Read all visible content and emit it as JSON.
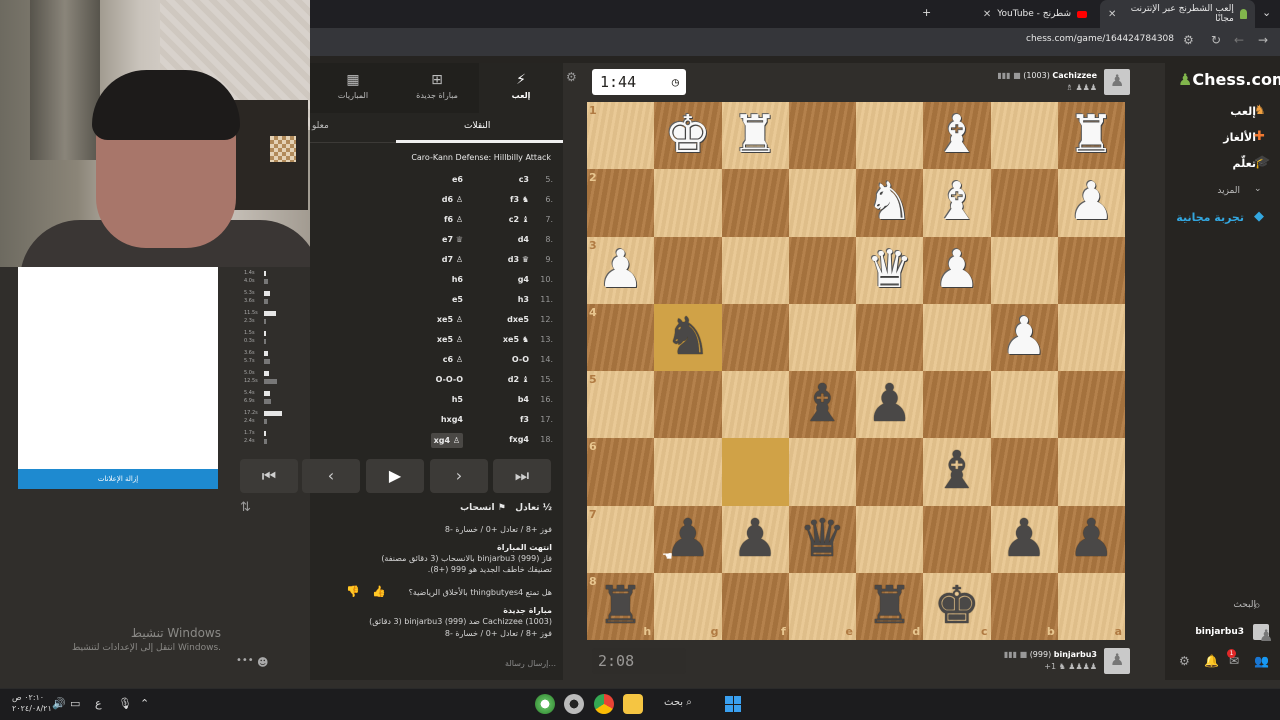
{
  "browser": {
    "tabs": [
      {
        "title": "إلعب الشطرنج عبر الإنترنت مجانًا",
        "active": true
      },
      {
        "title": "شطرنج - YouTube",
        "active": false
      }
    ],
    "new_tab": "+",
    "url": "chess.com/game/164424784308"
  },
  "overlay": {
    "remove_ads": "إزالة الإعلانات",
    "windows_activate_title": "تنشيط Windows",
    "windows_activate_sub": "انتقل إلى الإعدادات لتنشيط Windows."
  },
  "panel": {
    "tabs": [
      {
        "label": "إلعب",
        "icon": "lightning-icon"
      },
      {
        "label": "مباراة جديدة",
        "icon": "plus-square-icon"
      },
      {
        "label": "المباريات",
        "icon": "board-icon"
      }
    ],
    "subtabs": {
      "moves": "النقلات",
      "info": "معلو"
    },
    "opening": "Caro-Kann Defense: Hillbilly Attack",
    "moves": [
      {
        "num": "5.",
        "white": "c3",
        "black": "e6"
      },
      {
        "num": "6.",
        "white": "f3 ♞",
        "black": "d6 ♙"
      },
      {
        "num": "7.",
        "white": "c2 ♝",
        "black": "f6 ♙"
      },
      {
        "num": "8.",
        "white": "d4",
        "black": "e7 ♕"
      },
      {
        "num": "9.",
        "white": "d3 ♛",
        "black": "d7 ♙"
      },
      {
        "num": "10.",
        "white": "g4",
        "black": "h6"
      },
      {
        "num": "11.",
        "white": "h3",
        "black": "e5"
      },
      {
        "num": "12.",
        "white": "dxe5",
        "black": "xe5 ♙"
      },
      {
        "num": "13.",
        "white": "xe5 ♞",
        "black": "xe5 ♙"
      },
      {
        "num": "14.",
        "white": "O-O",
        "black": "c6 ♙"
      },
      {
        "num": "15.",
        "white": "d2 ♝",
        "black": "O-O-O"
      },
      {
        "num": "16.",
        "white": "b4",
        "black": "h5"
      },
      {
        "num": "17.",
        "white": "f3",
        "black": "hxg4"
      },
      {
        "num": "18.",
        "white": "fxg4",
        "black": "xg4 ♙"
      }
    ],
    "times": [
      [
        "1.4s",
        "4.0s"
      ],
      [
        "5.3s",
        "3.6s"
      ],
      [
        "11.5s",
        "2.3s"
      ],
      [
        "1.5s",
        "0.3s"
      ],
      [
        "3.6s",
        "5.7s"
      ],
      [
        "5.0s",
        "12.5s"
      ],
      [
        "5.4s",
        "6.9s"
      ],
      [
        "17.2s",
        "2.4s"
      ],
      [
        "1.7s",
        "2.4s"
      ]
    ],
    "draw_label": "½ تعادل",
    "resign_label": "انسحاب",
    "chat": {
      "line1": "فوز +8 / تعادل +0 / خسارة -8",
      "game_over": "انتهت المباراة",
      "result": "فاز binjarbu3 (999) بالانسحاب (3 دقائق مصنفة)",
      "rating": "تصنيفك خاطف الجديد هو 999 (+8).",
      "question": "هل تمتع thingbutyes4 بالأخلاق الرياضية؟",
      "new_game": "مباراة جديدة",
      "matchup": "Cachizzee (1003) ضد binjarbu3 (999) (3 دقائق)",
      "line2": "فوز +8 / تعادل +0 / خسارة -8"
    },
    "input_placeholder": "إرسال رسالة..."
  },
  "board": {
    "top_clock": "1:44",
    "bottom_clock": "2:08",
    "top_player": {
      "name": "Cachizzee",
      "rating": "(1003)"
    },
    "bottom_player": {
      "name": "binjarbu3",
      "rating": "(999)",
      "diff": "+1"
    },
    "ranks": [
      "1",
      "2",
      "3",
      "4",
      "5",
      "6",
      "7",
      "8"
    ],
    "files": [
      "h",
      "g",
      "f",
      "e",
      "d",
      "c",
      "b",
      "a"
    ],
    "pieces": [
      {
        "r": 0,
        "f": 1,
        "p": "♚",
        "c": "w"
      },
      {
        "r": 0,
        "f": 2,
        "p": "♜",
        "c": "w"
      },
      {
        "r": 0,
        "f": 5,
        "p": "♝",
        "c": "w"
      },
      {
        "r": 0,
        "f": 7,
        "p": "♜",
        "c": "w"
      },
      {
        "r": 1,
        "f": 4,
        "p": "♞",
        "c": "w"
      },
      {
        "r": 1,
        "f": 5,
        "p": "♝",
        "c": "w"
      },
      {
        "r": 1,
        "f": 7,
        "p": "♟",
        "c": "w"
      },
      {
        "r": 2,
        "f": 0,
        "p": "♟",
        "c": "w"
      },
      {
        "r": 2,
        "f": 4,
        "p": "♛",
        "c": "w"
      },
      {
        "r": 2,
        "f": 5,
        "p": "♟",
        "c": "w"
      },
      {
        "r": 3,
        "f": 1,
        "p": "♞",
        "c": "b"
      },
      {
        "r": 3,
        "f": 6,
        "p": "♟",
        "c": "w"
      },
      {
        "r": 4,
        "f": 3,
        "p": "♝",
        "c": "b"
      },
      {
        "r": 4,
        "f": 4,
        "p": "♟",
        "c": "b"
      },
      {
        "r": 5,
        "f": 5,
        "p": "♝",
        "c": "b"
      },
      {
        "r": 6,
        "f": 1,
        "p": "♟",
        "c": "b"
      },
      {
        "r": 6,
        "f": 2,
        "p": "♟",
        "c": "b"
      },
      {
        "r": 6,
        "f": 3,
        "p": "♛",
        "c": "b"
      },
      {
        "r": 6,
        "f": 6,
        "p": "♟",
        "c": "b"
      },
      {
        "r": 6,
        "f": 7,
        "p": "♟",
        "c": "b"
      },
      {
        "r": 7,
        "f": 0,
        "p": "♜",
        "c": "b"
      },
      {
        "r": 7,
        "f": 4,
        "p": "♜",
        "c": "b"
      },
      {
        "r": 7,
        "f": 5,
        "p": "♚",
        "c": "b"
      }
    ],
    "highlights": [
      {
        "r": 3,
        "f": 1
      },
      {
        "r": 5,
        "f": 2
      }
    ]
  },
  "sidebar": {
    "logo": "Chess.com",
    "nav": [
      "إلعب",
      "الألغاز",
      "تعلّم"
    ],
    "more": "المزيد",
    "free_trial": "تجربة مجانية",
    "search": "البحث",
    "username": "binjarbu3"
  },
  "taskbar": {
    "search": "بحث",
    "time": "٠٢:١٠ ص",
    "date": "٢٠٢٤/٠٨/٢١",
    "lang": "ع"
  },
  "colors": {
    "accent": "#81b64c",
    "link": "#33a7e0",
    "light_sq": "#e8c68f",
    "dark_sq": "#b07a42"
  }
}
